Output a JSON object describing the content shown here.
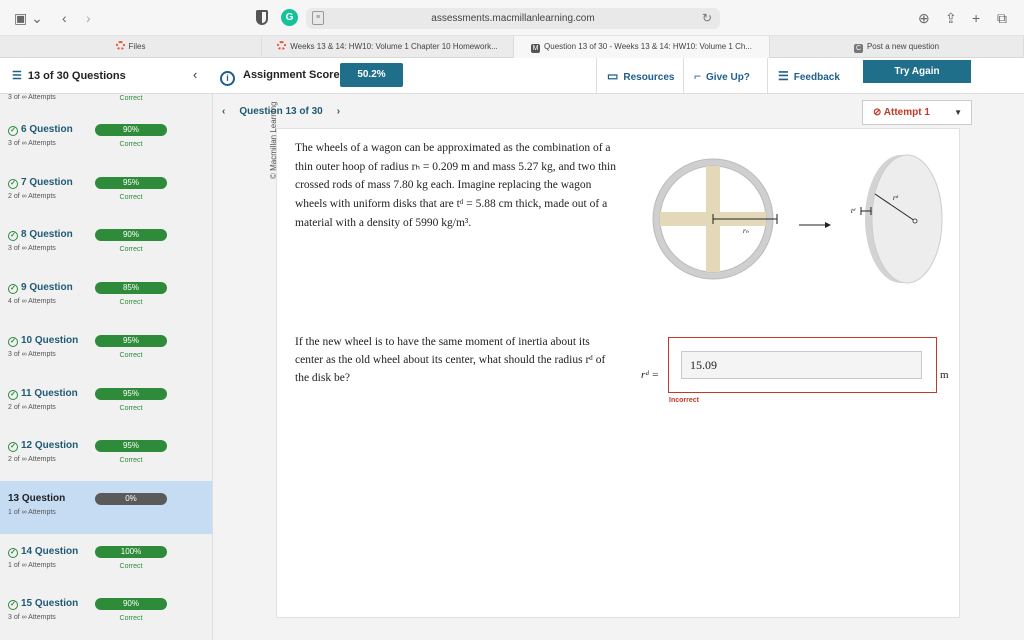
{
  "browser": {
    "url": "assessments.macmillanlearning.com",
    "tabs": [
      {
        "label": "Files"
      },
      {
        "label": "Weeks 13 & 14: HW10: Volume 1 Chapter 10 Homework..."
      },
      {
        "label": "Question 13 of 30 - Weeks 13 & 14: HW10: Volume 1 Ch..."
      },
      {
        "label": "Post a new question"
      }
    ]
  },
  "header": {
    "question_count": "13 of 30 Questions",
    "score_label": "Assignment Score:",
    "score_value": "50.2%",
    "resources": "Resources",
    "give_up": "Give Up?",
    "feedback": "Feedback",
    "try_again": "Try Again"
  },
  "sidebar": {
    "top_row": {
      "attempts": "3 of ∞ Attempts",
      "status": "Correct"
    },
    "questions": [
      {
        "title": "6 Question",
        "attempts": "3 of ∞ Attempts",
        "score": "90%",
        "status": "Correct"
      },
      {
        "title": "7 Question",
        "attempts": "2 of ∞ Attempts",
        "score": "95%",
        "status": "Correct"
      },
      {
        "title": "8 Question",
        "attempts": "3 of ∞ Attempts",
        "score": "90%",
        "status": "Correct"
      },
      {
        "title": "9 Question",
        "attempts": "4 of ∞ Attempts",
        "score": "85%",
        "status": "Correct"
      },
      {
        "title": "10 Question",
        "attempts": "3 of ∞ Attempts",
        "score": "95%",
        "status": "Correct"
      },
      {
        "title": "11 Question",
        "attempts": "2 of ∞ Attempts",
        "score": "95%",
        "status": "Correct"
      },
      {
        "title": "12 Question",
        "attempts": "2 of ∞ Attempts",
        "score": "95%",
        "status": "Correct"
      },
      {
        "title": "13 Question",
        "attempts": "1 of ∞ Attempts",
        "score": "0%",
        "status": ""
      },
      {
        "title": "14 Question",
        "attempts": "1 of ∞ Attempts",
        "score": "100%",
        "status": "Correct"
      },
      {
        "title": "15 Question",
        "attempts": "3 of ∞ Attempts",
        "score": "90%",
        "status": "Correct"
      }
    ]
  },
  "question": {
    "nav_label": "Question 13 of 30",
    "attempt": "Attempt 1",
    "copyright": "© Macmillan Learning",
    "problem_text": "The wheels of a wagon can be approximated as the combination of a thin outer hoop of radius rₕ = 0.209 m and mass 5.27 kg, and two thin crossed rods of mass 7.80 kg each. Imagine replacing the wagon wheels with uniform disks that are tᵈ = 5.88 cm thick, made out of a material with a density of 5990 kg/m³.",
    "prompt_text": "If the new wheel is to have the same moment of inertia about its center as the old wheel about its center, what should the radius rᵈ of the disk be?",
    "answer_label": "rᵈ =",
    "answer_value": "15.09",
    "unit": "m",
    "feedback": "Incorrect",
    "figure_labels": {
      "hoop_radius": "rₕ",
      "disk_radius": "rᵈ",
      "thickness": "tᵈ"
    }
  }
}
